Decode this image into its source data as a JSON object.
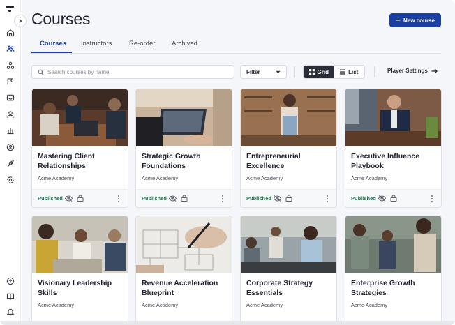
{
  "sidebar": {
    "items": [
      {
        "name": "home-icon"
      },
      {
        "name": "users-group-icon"
      },
      {
        "name": "nodes-icon"
      },
      {
        "name": "flag-icon"
      },
      {
        "name": "inbox-icon"
      },
      {
        "name": "user-icon"
      },
      {
        "name": "chart-icon"
      },
      {
        "name": "account-circle-icon"
      },
      {
        "name": "rocket-icon"
      },
      {
        "name": "settings-icon"
      }
    ],
    "bottom_items": [
      {
        "name": "upload-icon"
      },
      {
        "name": "book-icon"
      },
      {
        "name": "bell-icon"
      }
    ]
  },
  "header": {
    "title": "Courses",
    "new_course_label": "New course"
  },
  "tabs": [
    {
      "label": "Courses",
      "active": true
    },
    {
      "label": "Instructors",
      "active": false
    },
    {
      "label": "Re-order",
      "active": false
    },
    {
      "label": "Archived",
      "active": false
    }
  ],
  "toolbar": {
    "search_placeholder": "Search courses by name",
    "filter_label": "Filter",
    "grid_label": "Grid",
    "list_label": "List",
    "view_selected": "Grid",
    "player_settings_label": "Player Settings"
  },
  "colors": {
    "accent": "#1a3fa0",
    "published": "#1e7a55",
    "dark_button": "#2b2e38"
  },
  "courses": [
    {
      "title": "Mastering Client Relationships",
      "org": "Acme Academy",
      "status": "Published"
    },
    {
      "title": "Strategic Growth Foundations",
      "org": "Acme Academy",
      "status": "Published"
    },
    {
      "title": "Entrepreneurial Excellence",
      "org": "Acme Academy",
      "status": "Published"
    },
    {
      "title": "Executive Influence Playbook",
      "org": "Acme Academy",
      "status": "Published"
    },
    {
      "title": "Visionary Leadership Skills",
      "org": "Acme Academy",
      "status": ""
    },
    {
      "title": "Revenue Acceleration Blueprint",
      "org": "Acme Academy",
      "status": ""
    },
    {
      "title": "Corporate Strategy Essentials",
      "org": "Acme Academy",
      "status": ""
    },
    {
      "title": "Enterprise Growth Strategies",
      "org": "Acme Academy",
      "status": ""
    }
  ]
}
